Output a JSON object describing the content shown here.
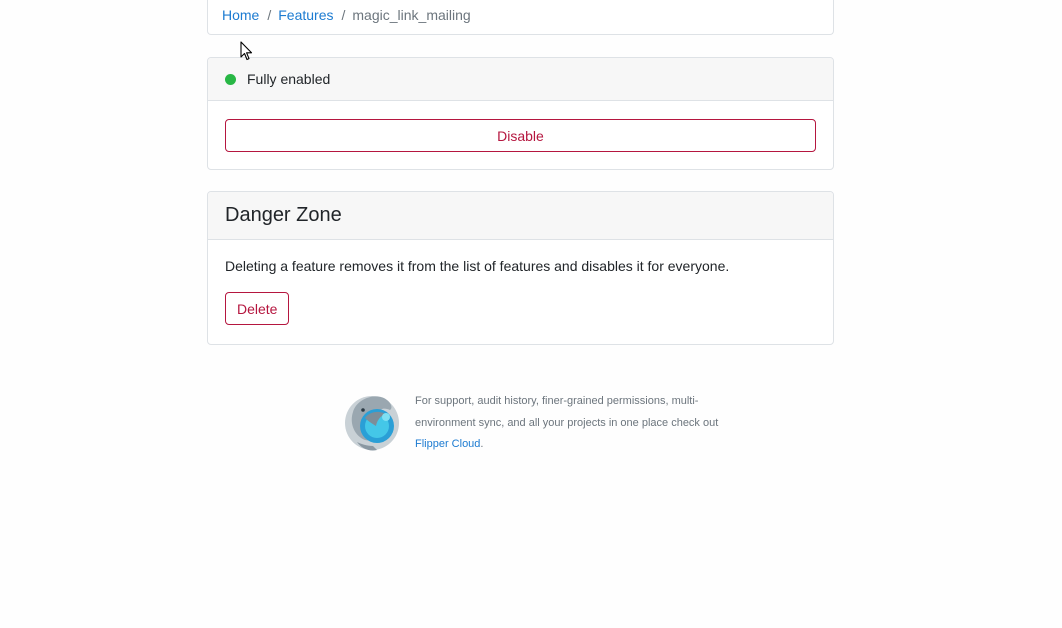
{
  "breadcrumb": {
    "home": "Home",
    "features": "Features",
    "separator": "/",
    "current": "magic_link_mailing"
  },
  "status": {
    "label": "Fully enabled",
    "color": "#28b745",
    "disable_label": "Disable"
  },
  "danger_zone": {
    "title": "Danger Zone",
    "description": "Deleting a feature removes it from the list of features and disables it for everyone.",
    "delete_label": "Delete"
  },
  "promo": {
    "text": "For support, audit history, finer-grained permissions, multi-environment sync, and all your projects in one place check out ",
    "link": "Flipper Cloud",
    "suffix": "."
  },
  "colors": {
    "link": "#1c7bd1",
    "danger": "#b5163f",
    "success": "#28b745"
  }
}
